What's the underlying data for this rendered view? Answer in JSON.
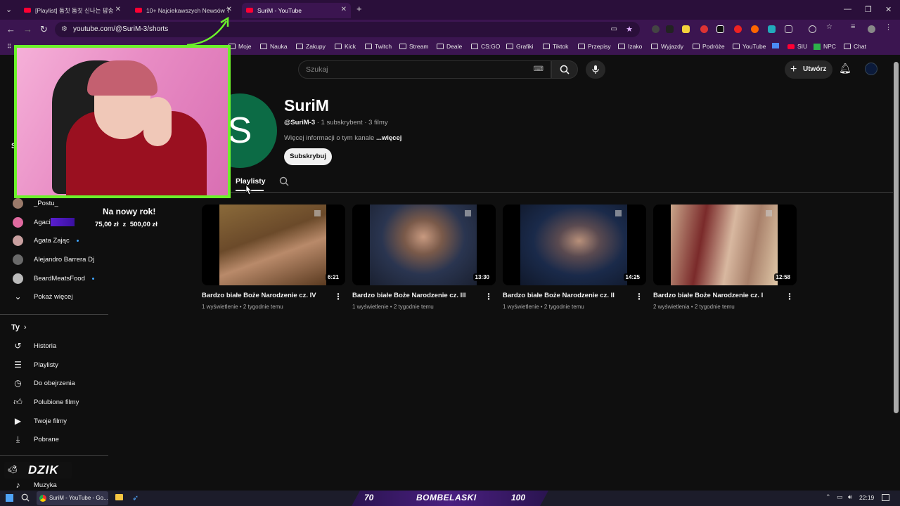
{
  "browser": {
    "tabs": [
      {
        "label": "[Playlist] 둠칫 둠칫 신나는 팝송",
        "active": false
      },
      {
        "label": "10+ Najciekawszych Newsów T",
        "active": false
      },
      {
        "label": "SuriM - YouTube",
        "active": true
      }
    ],
    "new_tab": "+",
    "url": "youtube.com/@SuriM-3/shorts",
    "bookmarks": [
      "Moje",
      "Nauka",
      "Zakupy",
      "Kick",
      "Twitch",
      "Stream",
      "Deale",
      "CS:GO",
      "Grafiki",
      "Tiktok",
      "Przepisy",
      "Izako",
      "Wyjazdy",
      "Podróże",
      "YouTube",
      "SIU",
      "NPC",
      "Chat"
    ]
  },
  "masthead": {
    "search_placeholder": "Szukaj",
    "create_label": "Utwórz"
  },
  "sidebar": {
    "subscriptions": [
      {
        "name": "_Postu_",
        "dot": false,
        "color": "#9a7a6a"
      },
      {
        "name": "Agaci",
        "dot": false,
        "color": "#e06aa0"
      },
      {
        "name": "Agata Zając",
        "dot": true,
        "color": "#c9a0a0"
      },
      {
        "name": "Alejandro Barrera Dj",
        "dot": false,
        "color": "#6a6a6a"
      },
      {
        "name": "BeardMeatsFood",
        "dot": true,
        "color": "#bbbbbb"
      }
    ],
    "show_more": "Pokaż więcej",
    "you_heading": "Ty",
    "you_items": [
      {
        "label": "Historia",
        "icon": "history-icon"
      },
      {
        "label": "Playlisty",
        "icon": "playlist-icon"
      },
      {
        "label": "Do obejrzenia",
        "icon": "clock-icon"
      },
      {
        "label": "Polubione filmy",
        "icon": "thumb-up-icon"
      },
      {
        "label": "Twoje filmy",
        "icon": "video-icon"
      },
      {
        "label": "Pobrane",
        "icon": "download-icon"
      }
    ],
    "music": "Muzyka"
  },
  "channel": {
    "avatar_letter": "S",
    "name": "SuriM",
    "handle": "@SuriM-3",
    "stats": " · 1 subskrybent · 3 filmy",
    "description": "Więcej informacji o tym kanale ",
    "more": "...więcej",
    "subscribe": "Subskrybuj",
    "active_tab": "Playlisty"
  },
  "videos": [
    {
      "title": "Bardzo białe Boże Narodzenie cz. IV",
      "duration": "6:21",
      "views": "1 wyświetlenie",
      "age": "2 tygodnie temu"
    },
    {
      "title": "Bardzo białe Boże Narodzenie cz. III",
      "duration": "13:30",
      "views": "1 wyświetlenie",
      "age": "2 tygodnie temu"
    },
    {
      "title": "Bardzo białe Boże Narodzenie cz. II",
      "duration": "14:25",
      "views": "1 wyświetlenie",
      "age": "2 tygodnie temu"
    },
    {
      "title": "Bardzo białe Boże Narodzenie cz. I",
      "duration": "12:58",
      "views": "2 wyświetlenia",
      "age": "2 tygodnie temu"
    }
  ],
  "overlay": {
    "goal_title": "Na nowy rok!",
    "goal_current": "75,00 zł",
    "goal_sep": "z",
    "goal_target": "500,00 zł",
    "brand": "DZIK",
    "scoreboard_left": "70",
    "scoreboard_name": "BOMBELASKI",
    "scoreboard_right": "100"
  },
  "taskbar": {
    "window_title": "SuriM - YouTube - Go...",
    "time": "22:19"
  }
}
